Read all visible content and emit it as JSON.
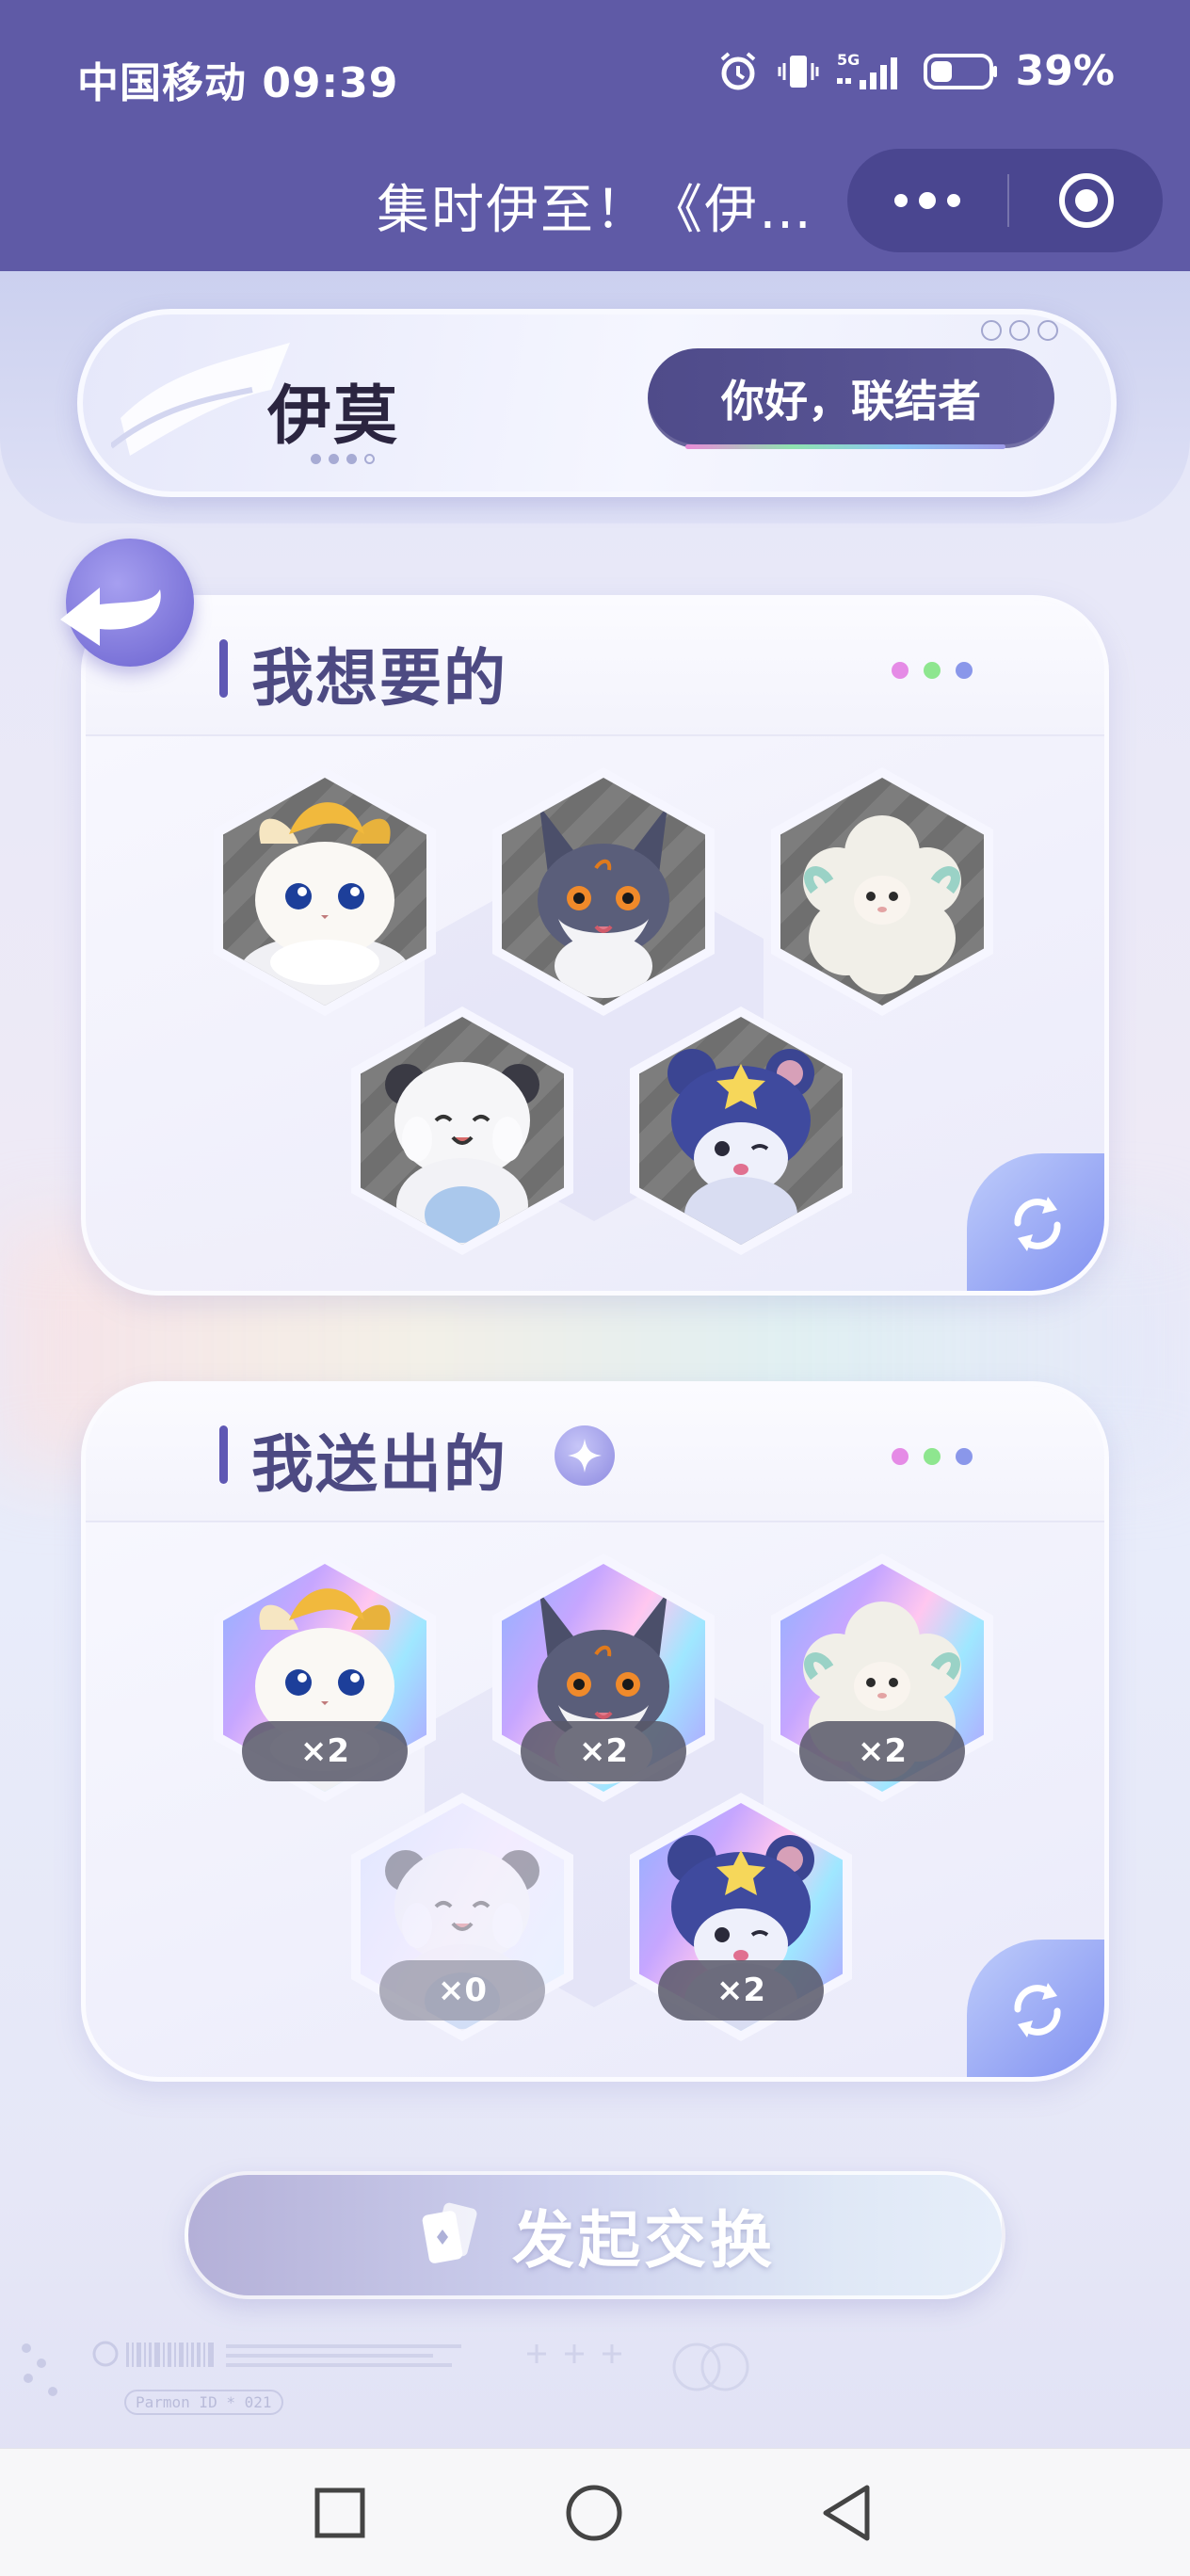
{
  "status_bar": {
    "carrier_time": "中国移动 09:39",
    "network": "5G",
    "battery": "39%",
    "icons": [
      "alarm-icon",
      "vibrate-icon",
      "signal-icon",
      "battery-icon"
    ]
  },
  "title_bar": {
    "title": "集时伊至！《伊…",
    "more_icon": "more-dots-icon",
    "close_icon": "target-close-icon"
  },
  "header": {
    "logo": "伊莫",
    "greeting": "你好，联结者"
  },
  "wanted": {
    "title": "我想要的",
    "items": [
      {
        "name": "golden-fox-creature"
      },
      {
        "name": "dark-fox-creature"
      },
      {
        "name": "fluffy-sheep-creature"
      },
      {
        "name": "white-bear-creature"
      },
      {
        "name": "star-squirrel-creature"
      }
    ],
    "refresh_icon": "refresh-icon"
  },
  "given": {
    "title": "我送出的",
    "items": [
      {
        "name": "golden-fox-creature",
        "count": "×2"
      },
      {
        "name": "dark-fox-creature",
        "count": "×2"
      },
      {
        "name": "fluffy-sheep-creature",
        "count": "×2"
      },
      {
        "name": "white-bear-creature",
        "count": "×0"
      },
      {
        "name": "star-squirrel-creature",
        "count": "×2"
      }
    ],
    "refresh_icon": "refresh-icon"
  },
  "exchange_button": "发起交换",
  "footer": {
    "meta": "Parmon ID * 021"
  },
  "colors": {
    "topbar": "#5f5aa6",
    "accent": "#5f58b4",
    "title_text": "#4d4a82",
    "dot_pink": "#e58be6",
    "dot_green": "#8ee68f",
    "dot_blue": "#8a97ea"
  }
}
